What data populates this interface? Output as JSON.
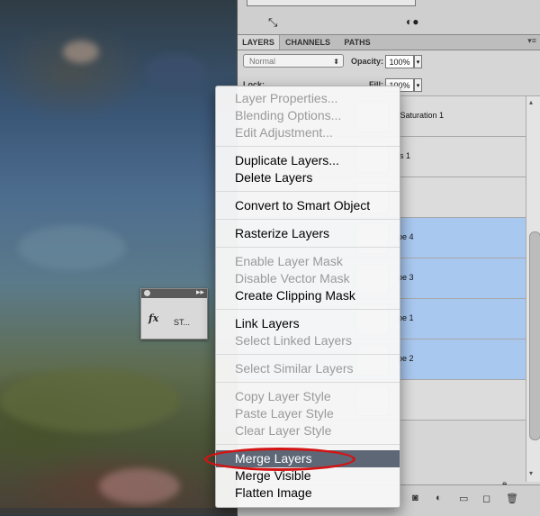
{
  "panel": {
    "tabs": [
      "LAYERS",
      "CHANNELS",
      "PATHS"
    ],
    "blend_mode": "Normal",
    "opacity_label": "Opacity:",
    "opacity_value": "100%",
    "lock_label": "Lock:",
    "fill_label": "Fill:",
    "fill_value": "100%",
    "layers": [
      {
        "name": "/Saturation 1",
        "selected": false
      },
      {
        "name": "ls 1",
        "selected": false
      },
      {
        "name": "",
        "selected": false
      },
      {
        "name": "pe 4",
        "selected": true
      },
      {
        "name": "pe 3",
        "selected": true
      },
      {
        "name": "pe 1",
        "selected": true
      },
      {
        "name": "pe 2",
        "selected": true
      },
      {
        "name": "",
        "selected": false
      }
    ]
  },
  "mini_panel": {
    "label": "ST..."
  },
  "context_menu": {
    "groups": [
      [
        {
          "label": "Layer Properties...",
          "enabled": false
        },
        {
          "label": "Blending Options...",
          "enabled": false
        },
        {
          "label": "Edit Adjustment...",
          "enabled": false
        }
      ],
      [
        {
          "label": "Duplicate Layers...",
          "enabled": true
        },
        {
          "label": "Delete Layers",
          "enabled": true
        }
      ],
      [
        {
          "label": "Convert to Smart Object",
          "enabled": true
        }
      ],
      [
        {
          "label": "Rasterize Layers",
          "enabled": true
        }
      ],
      [
        {
          "label": "Enable Layer Mask",
          "enabled": false
        },
        {
          "label": "Disable Vector Mask",
          "enabled": false
        },
        {
          "label": "Create Clipping Mask",
          "enabled": true
        }
      ],
      [
        {
          "label": "Link Layers",
          "enabled": true
        },
        {
          "label": "Select Linked Layers",
          "enabled": false
        }
      ],
      [
        {
          "label": "Select Similar Layers",
          "enabled": false
        }
      ],
      [
        {
          "label": "Copy Layer Style",
          "enabled": false
        },
        {
          "label": "Paste Layer Style",
          "enabled": false
        },
        {
          "label": "Clear Layer Style",
          "enabled": false
        }
      ],
      [
        {
          "label": "Merge Layers",
          "enabled": true,
          "highlighted": true
        },
        {
          "label": "Merge Visible",
          "enabled": true
        },
        {
          "label": "Flatten Image",
          "enabled": true
        }
      ]
    ]
  },
  "colors": {
    "selection": "#a9c8f0",
    "menu_highlight": "#5d6776",
    "annotation_ring": "#d41313"
  }
}
